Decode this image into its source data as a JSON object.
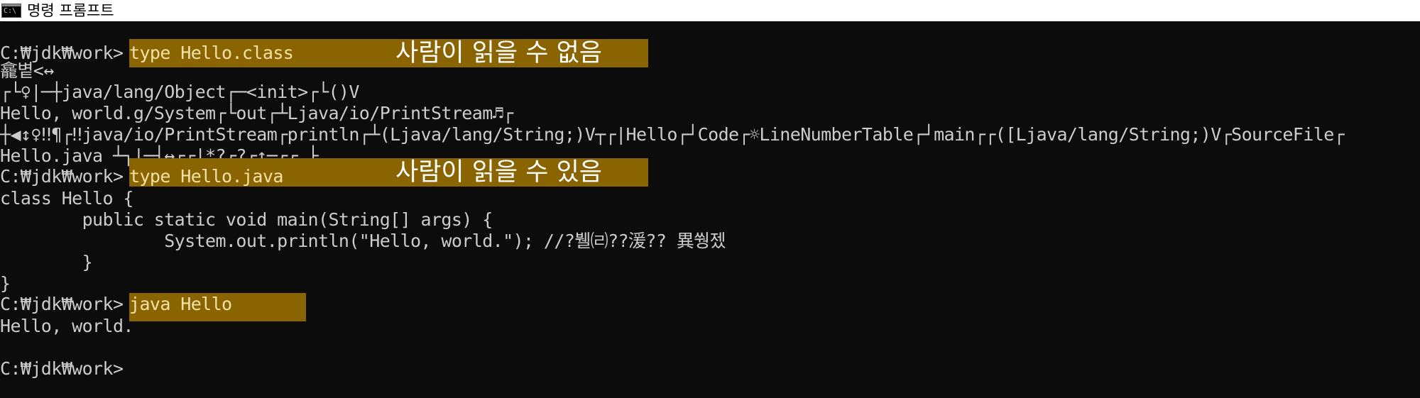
{
  "window": {
    "icon_text": "C:\\",
    "title": "명령 프롬프트"
  },
  "terminal": {
    "blank_top": "",
    "cmd1": {
      "prompt": "C:₩jdk₩work>",
      "command": "type Hello.class",
      "note": "사람이 읽을 수 없음"
    },
    "class_output": [
      "龕볕<↔",
      "┌└♀|─┼java/lang/Object┌─<init>┌└()V",
      "Hello, world.g/System┌└out┌┴Ljava/io/PrintStream♬┌",
      "┼◀↕♀‼¶┌‼java/io/PrintStream┌println┌┴(Ljava/lang/String;)V┬┌|Hello┌┘Code┌☼LineNumberTable┌┘main┌┌([Ljava/lang/String;)V┌SourceFile┌",
      "Hello.java ┴┐|─┤↔┌┌|*?┌?┌↑─┌┌ ├"
    ],
    "cmd2": {
      "prompt": "C:₩jdk₩work>",
      "command": "type Hello.java",
      "note": "사람이 읽을 수 있음"
    },
    "java_output": [
      "class Hello {",
      "        public static void main(String[] args) {",
      "                System.out.println(\"Hello, world.\"); //?뷀㈃??湲?? 異쒕젰",
      "        }",
      "}"
    ],
    "cmd3": {
      "prompt": "C:₩jdk₩work>",
      "command": "java Hello"
    },
    "run_output": "Hello, world.",
    "blank_line": "",
    "final_prompt": "C:₩jdk₩work>"
  },
  "colors": {
    "background": "#0c0c0c",
    "text": "#cccccc",
    "highlight": "#8a6400",
    "highlight_text": "#f3e2a6",
    "note_text": "#ffffff"
  }
}
